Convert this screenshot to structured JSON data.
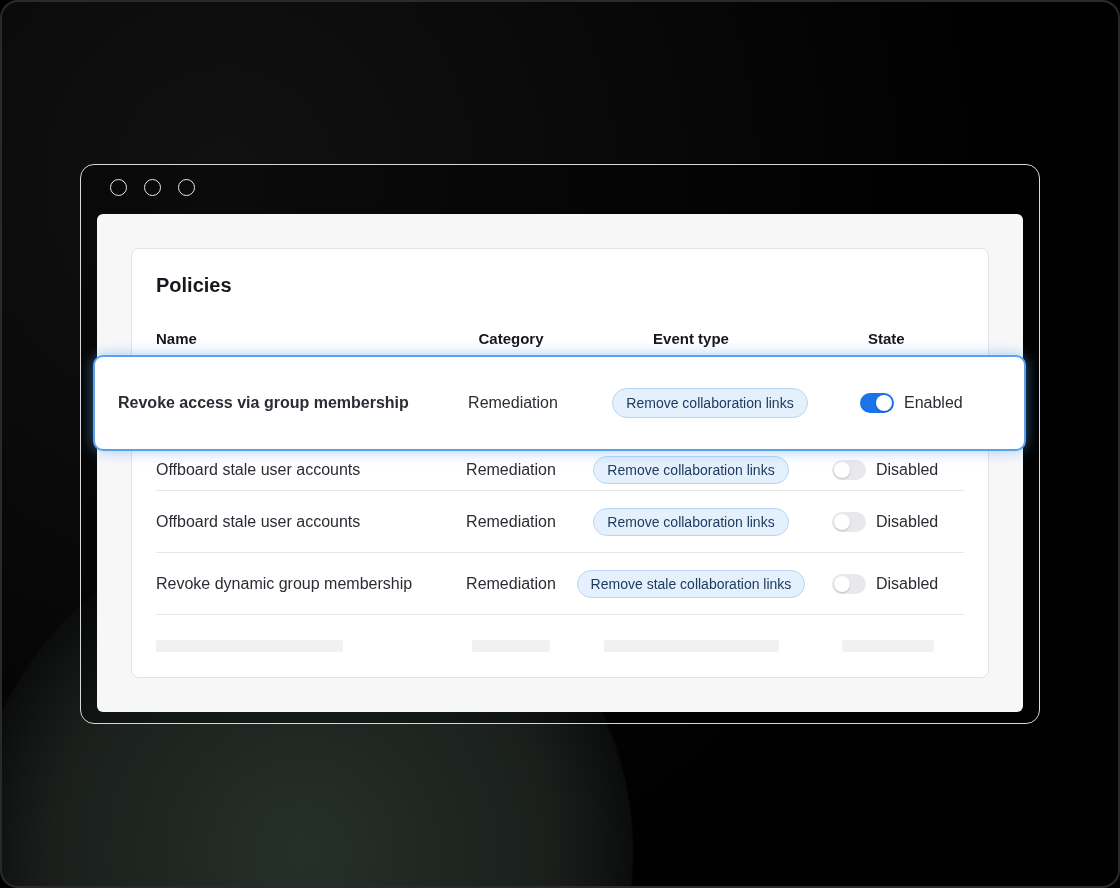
{
  "card": {
    "title": "Policies"
  },
  "table": {
    "columns": [
      "Name",
      "Category",
      "Event type",
      "State"
    ],
    "highlighted_row": {
      "name": "Revoke access via group membership",
      "category": "Remediation",
      "event_type": "Remove collaboration links",
      "enabled": true,
      "state": "Enabled"
    },
    "rows": [
      {
        "name": "Offboard stale user accounts",
        "category": "Remediation",
        "event_type": "Remove collaboration links",
        "enabled": false,
        "state": "Disabled"
      },
      {
        "name": "Offboard stale user accounts",
        "category": "Remediation",
        "event_type": "Remove collaboration links",
        "enabled": false,
        "state": "Disabled"
      },
      {
        "name": "Revoke dynamic group membership",
        "category": "Remediation",
        "event_type": "Remove stale collaboration links",
        "enabled": false,
        "state": "Disabled"
      }
    ]
  }
}
